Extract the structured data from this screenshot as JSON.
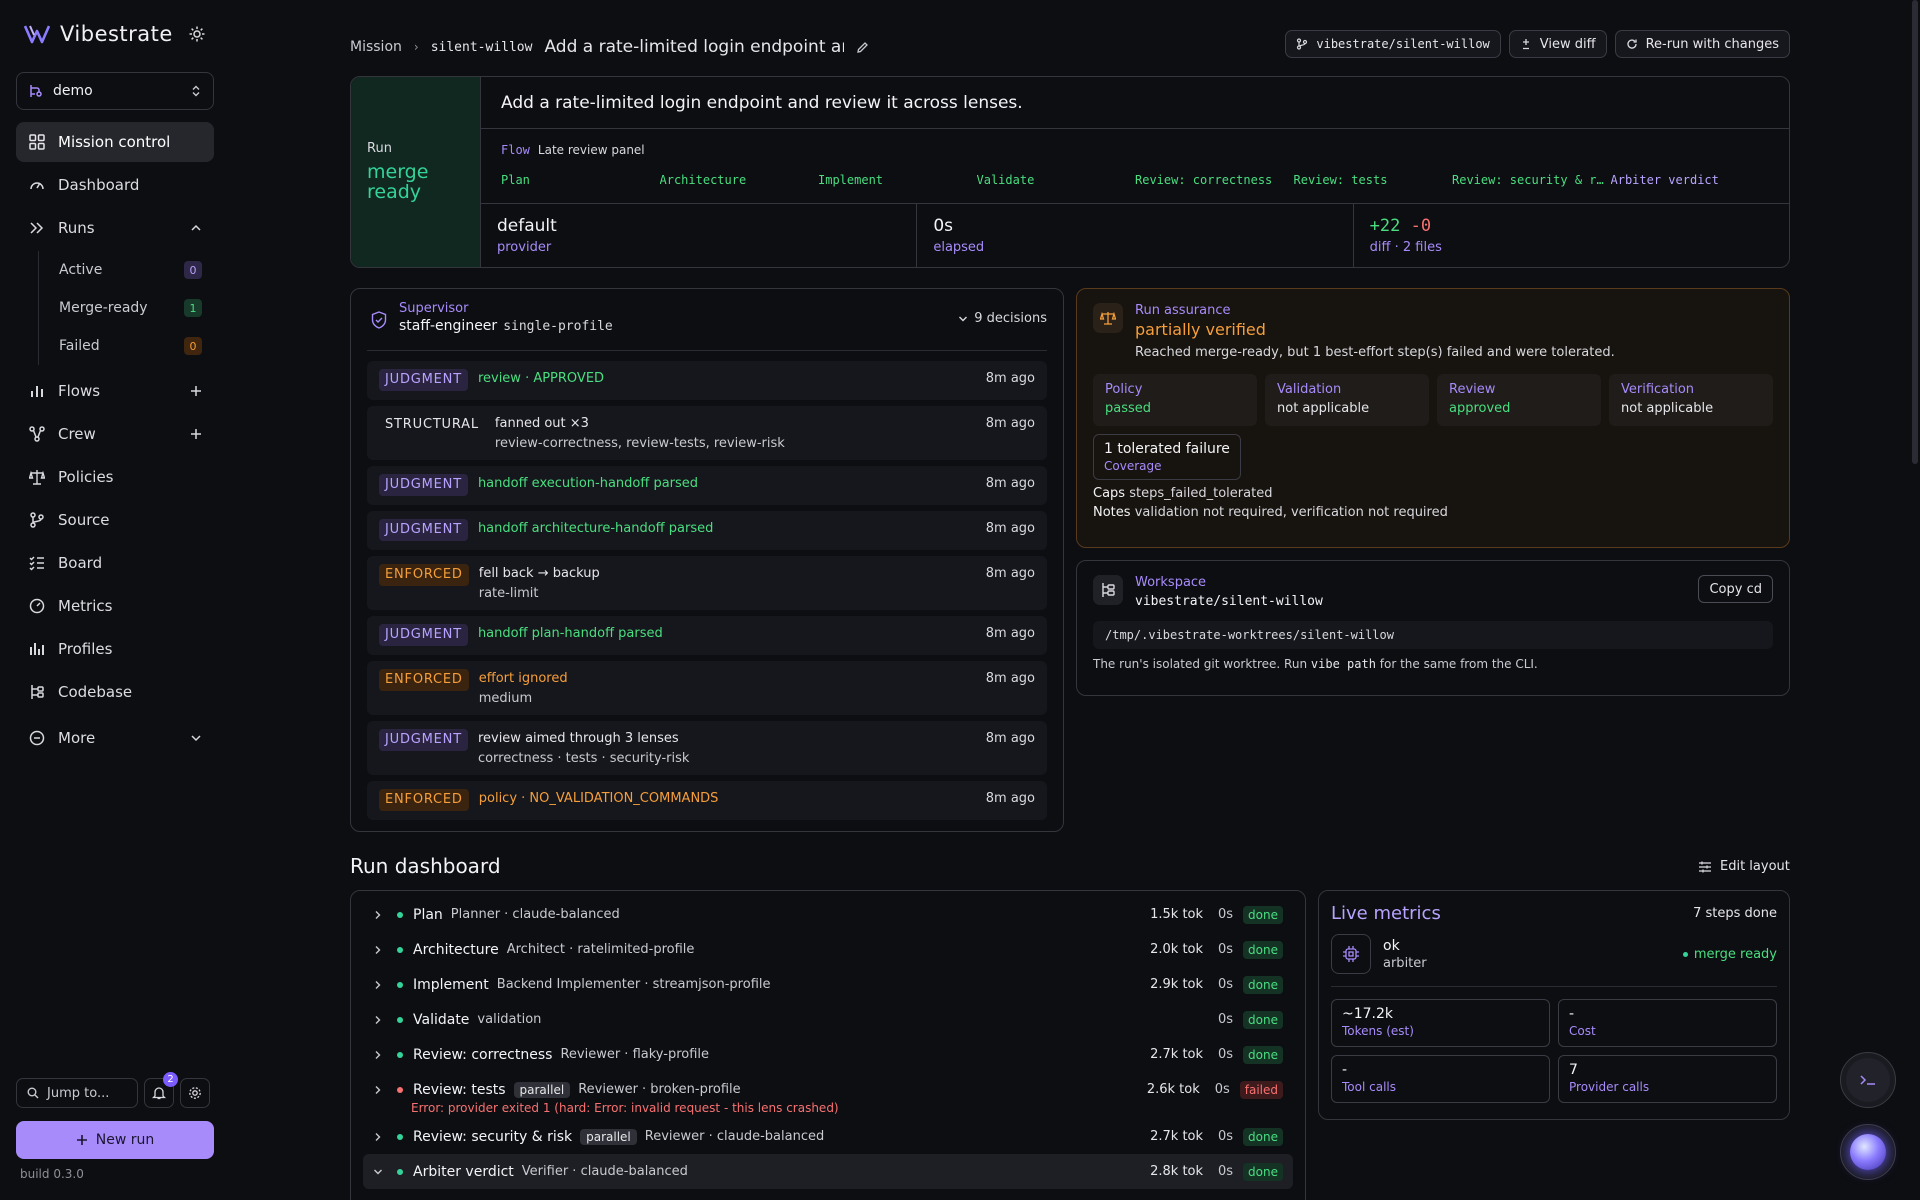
{
  "brand": {
    "name": "Vibestrate"
  },
  "workspace": {
    "label": "demo"
  },
  "nav": {
    "mission_control": "Mission control",
    "dashboard": "Dashboard",
    "runs": "Runs",
    "runs_sub": [
      {
        "label": "Active",
        "count": "0"
      },
      {
        "label": "Merge-ready",
        "count": "1"
      },
      {
        "label": "Failed",
        "count": "0"
      }
    ],
    "flows": "Flows",
    "crew": "Crew",
    "policies": "Policies",
    "source": "Source",
    "board": "Board",
    "metrics": "Metrics",
    "profiles": "Profiles",
    "codebase": "Codebase",
    "more": "More"
  },
  "sidebar_bottom": {
    "jump_placeholder": "Jump to...",
    "notif_count": "2",
    "new_run": "New run",
    "build": "build 0.3.0"
  },
  "header": {
    "crumb_root": "Mission",
    "crumb_id": "silent-willow",
    "crumb_title": "Add a rate-limited login endpoint and...",
    "branch": "vibestrate/silent-willow",
    "view_diff": "View diff",
    "rerun": "Re-run with changes"
  },
  "run": {
    "status_key": "Run",
    "status_value": "merge ready",
    "title": "Add a rate-limited login endpoint and review it across lenses.",
    "flow_key": "Flow",
    "flow_value": "Late review panel",
    "steps": [
      "Plan",
      "Architecture",
      "Implement",
      "Validate",
      "Review: correctness",
      "Review: tests",
      "Review: security & r…",
      "Arbiter verdict"
    ],
    "stats": {
      "provider_value": "default",
      "provider_label": "provider",
      "elapsed_value": "0s",
      "elapsed_label": "elapsed",
      "diff_add": "+22",
      "diff_del": "-0",
      "diff_label": "diff · 2 files"
    }
  },
  "supervisor": {
    "key": "Supervisor",
    "name": "staff-engineer",
    "profile": "single-profile",
    "decisions": "9 decisions",
    "rows": [
      {
        "tag": "JUDGMENT",
        "kind": "judgment",
        "t1": "review · APPROVED",
        "t1c": "green",
        "t2": "",
        "time": "8m ago"
      },
      {
        "tag": "STRUCTURAL",
        "kind": "structural",
        "t1": "fanned out ×3",
        "t1c": "white",
        "t2": "review-correctness, review-tests, review-risk",
        "time": "8m ago"
      },
      {
        "tag": "JUDGMENT",
        "kind": "judgment",
        "t1": "handoff execution-handoff parsed",
        "t1c": "green",
        "t2": "",
        "time": "8m ago"
      },
      {
        "tag": "JUDGMENT",
        "kind": "judgment",
        "t1": "handoff architecture-handoff parsed",
        "t1c": "green",
        "t2": "",
        "time": "8m ago"
      },
      {
        "tag": "ENFORCED",
        "kind": "enforced",
        "t1": "fell back → backup",
        "t1c": "white",
        "t2": "rate-limit",
        "time": "8m ago"
      },
      {
        "tag": "JUDGMENT",
        "kind": "judgment",
        "t1": "handoff plan-handoff parsed",
        "t1c": "green",
        "t2": "",
        "time": "8m ago"
      },
      {
        "tag": "ENFORCED",
        "kind": "enforced",
        "t1": "effort ignored",
        "t1c": "orange",
        "t2": "medium",
        "time": "8m ago"
      },
      {
        "tag": "JUDGMENT",
        "kind": "judgment",
        "t1": "review aimed through 3 lenses",
        "t1c": "white",
        "t2": "correctness · tests · security-risk",
        "time": "8m ago"
      },
      {
        "tag": "ENFORCED",
        "kind": "enforced",
        "t1": "policy · NO_VALIDATION_COMMANDS",
        "t1c": "orange",
        "t2": "",
        "time": "8m ago"
      }
    ]
  },
  "assurance": {
    "key": "Run assurance",
    "value": "partially verified",
    "desc": "Reached merge-ready, but 1 best-effort step(s) failed and were tolerated.",
    "cells": [
      {
        "k": "Policy",
        "v": "passed",
        "green": true
      },
      {
        "k": "Validation",
        "v": "not applicable",
        "green": false
      },
      {
        "k": "Review",
        "v": "approved",
        "green": true
      },
      {
        "k": "Verification",
        "v": "not applicable",
        "green": false
      }
    ],
    "tolerated_value": "1 tolerated failure",
    "tolerated_label": "Coverage",
    "caps_key": "Caps",
    "caps_value": "steps_failed_tolerated",
    "notes_key": "Notes",
    "notes_value": "validation not required, verification not required"
  },
  "workspace_card": {
    "key": "Workspace",
    "branch": "vibestrate/silent-willow",
    "copy": "Copy cd",
    "path": "/tmp/.vibestrate-worktrees/silent-willow",
    "note_a": "The run's isolated git worktree. Run",
    "note_cmd": "vibe path",
    "note_b": "for the same from the CLI."
  },
  "dashboard": {
    "title": "Run dashboard",
    "edit_layout": "Edit layout",
    "steps": [
      {
        "name": "Plan",
        "par": "",
        "desc": "Planner · claude-balanced",
        "tok": "1.5k tok",
        "dur": "0s",
        "status": "done",
        "err": ""
      },
      {
        "name": "Architecture",
        "par": "",
        "desc": "Architect · ratelimited-profile",
        "tok": "2.0k tok",
        "dur": "0s",
        "status": "done",
        "err": ""
      },
      {
        "name": "Implement",
        "par": "",
        "desc": "Backend Implementer · streamjson-profile",
        "tok": "2.9k tok",
        "dur": "0s",
        "status": "done",
        "err": ""
      },
      {
        "name": "Validate",
        "par": "",
        "desc": "validation",
        "tok": "",
        "dur": "0s",
        "status": "done",
        "err": ""
      },
      {
        "name": "Review: correctness",
        "par": "",
        "desc": "Reviewer · flaky-profile",
        "tok": "2.7k tok",
        "dur": "0s",
        "status": "done",
        "err": ""
      },
      {
        "name": "Review: tests",
        "par": "parallel",
        "desc": "Reviewer · broken-profile",
        "tok": "2.6k tok",
        "dur": "0s",
        "status": "failed",
        "err": "Error: provider exited 1 (hard: Error: invalid request - this lens crashed)"
      },
      {
        "name": "Review: security & risk",
        "par": "parallel",
        "desc": "Reviewer · claude-balanced",
        "tok": "2.7k tok",
        "dur": "0s",
        "status": "done",
        "err": ""
      },
      {
        "name": "Arbiter verdict",
        "par": "",
        "desc": "Verifier · claude-balanced",
        "tok": "2.8k tok",
        "dur": "0s",
        "status": "done",
        "err": "",
        "expanded": true
      }
    ]
  },
  "live": {
    "title": "Live metrics",
    "steps_done": "7 steps done",
    "arbiter_value": "ok",
    "arbiter_label": "arbiter",
    "merge_ready": "merge ready",
    "cells": [
      {
        "v": "~17.2k",
        "l": "Tokens (est)"
      },
      {
        "v": "-",
        "l": "Cost"
      },
      {
        "v": "-",
        "l": "Tool calls"
      },
      {
        "v": "7",
        "l": "Provider calls"
      }
    ]
  },
  "colors": {
    "accent": "#a78bfa",
    "success": "#4ade80",
    "warning": "#f59e3b",
    "danger": "#f87171"
  }
}
